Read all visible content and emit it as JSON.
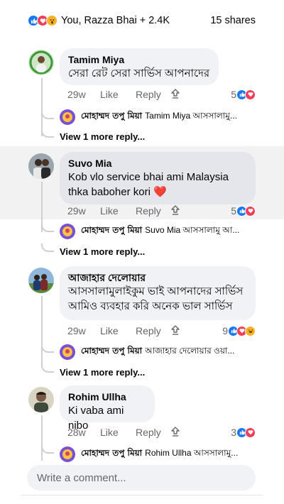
{
  "summary": {
    "reaction_icons": [
      "like-icon",
      "love-icon",
      "wow-icon"
    ],
    "names": "You, Razza Bhai + 2.4K",
    "shares": "15 shares"
  },
  "actions_labels": {
    "like": "Like",
    "reply": "Reply"
  },
  "comments": [
    {
      "author": "Tamim Miya",
      "text": "সেরা রেট সেরা সার্ভিস আপনাদের",
      "time": "29w",
      "reaction_count": "5",
      "reactions": [
        "like-icon",
        "love-icon"
      ],
      "reply": {
        "author": "মোহাম্মদ তপু মিয়া",
        "text": "Tamim Miya আসসালামু..."
      },
      "view_more": "View 1 more reply..."
    },
    {
      "author": "Suvo Mia",
      "text": "Kob vlo service bhai ami Malaysia thka baboher kori ❤️",
      "time": "29w",
      "reaction_count": "5",
      "reactions": [
        "like-icon",
        "love-icon"
      ],
      "reply": {
        "author": "মোহাম্মদ তপু মিয়া",
        "text": "Suvo Mia আসসালামু আ..."
      },
      "view_more": "View 1 more reply..."
    },
    {
      "author": "আজাহার দেলোয়ার",
      "text": "আসসালামুলাইকুম ভাই আপনাদের সার্ভিস আমিও ব্যবহার করি অনেক ভাল সার্ভিস",
      "time": "29w",
      "reaction_count": "9",
      "reactions": [
        "like-icon",
        "love-icon",
        "haha-icon"
      ],
      "reply": {
        "author": "মোহাম্মদ তপু মিয়া",
        "text": "আজাহার দেলোয়ার ওয়া..."
      },
      "view_more": "View 1 more reply..."
    },
    {
      "author": "Rohim Ullha",
      "text": "Ki vaba ami nibo",
      "time": "28w",
      "reaction_count": "3",
      "reactions": [
        "like-icon",
        "love-icon"
      ],
      "reply": {
        "author": "মোহাম্মদ তপু মিয়া",
        "text": "Rohim Ullha আসসালামু..."
      }
    }
  ],
  "composer": {
    "placeholder": "Write a comment..."
  },
  "colors": {
    "like": "#1877f2",
    "love": "#f33e58",
    "wow": "#f7b125",
    "highlight": "#f2f2f2"
  }
}
